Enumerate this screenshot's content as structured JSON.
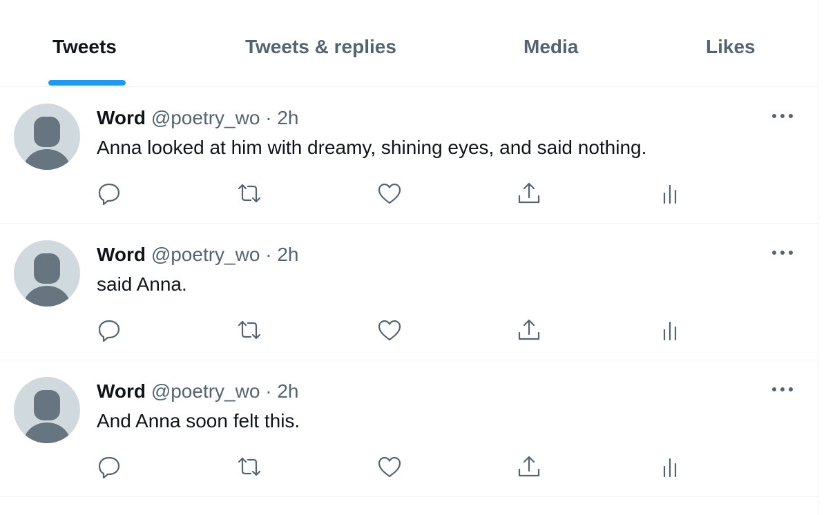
{
  "tabs": [
    {
      "label": "Tweets",
      "active": true
    },
    {
      "label": "Tweets & replies",
      "active": false
    },
    {
      "label": "Media",
      "active": false
    },
    {
      "label": "Likes",
      "active": false
    }
  ],
  "colors": {
    "accent": "#1d9bf0",
    "text": "#0f1419",
    "secondary": "#536471",
    "border": "#eff3f4"
  },
  "icons": [
    "reply-icon",
    "retweet-icon",
    "like-icon",
    "share-icon",
    "analytics-icon",
    "more-icon"
  ],
  "tweets": [
    {
      "name": "Word",
      "handle": "@poetry_wo",
      "separator": "·",
      "time": "2h",
      "text": "Anna looked at him with dreamy, shining eyes, and said nothing."
    },
    {
      "name": "Word",
      "handle": "@poetry_wo",
      "separator": "·",
      "time": "2h",
      "text": "said Anna."
    },
    {
      "name": "Word",
      "handle": "@poetry_wo",
      "separator": "·",
      "time": "2h",
      "text": "And Anna soon felt this."
    }
  ]
}
